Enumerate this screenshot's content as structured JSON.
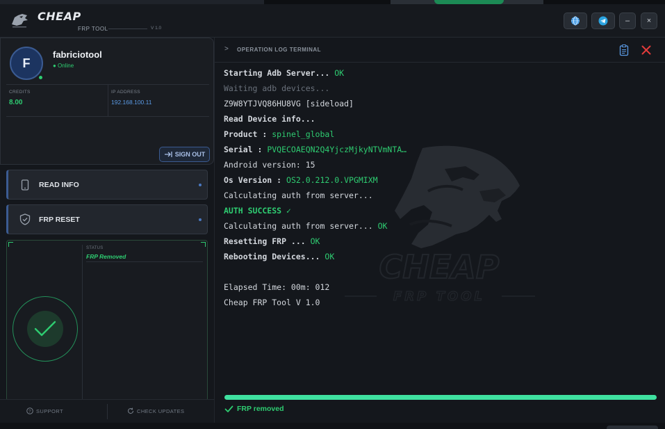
{
  "app": {
    "brand": "CHEAP",
    "subtitle": "FRP TOOL",
    "version": "V 1.0"
  },
  "header": {
    "buttons": [
      {
        "name": "globe-icon"
      },
      {
        "name": "telegram-icon"
      },
      {
        "name": "minimize-icon",
        "label": "–"
      },
      {
        "name": "close-icon",
        "label": "×"
      }
    ]
  },
  "profile": {
    "avatar_initial": "F",
    "username": "fabriciotool",
    "status": "● Online",
    "credits_label": "CREDITS",
    "credits_value": "8.00",
    "ip_label": "IP ADDRESS",
    "ip_value": "192.168.100.11",
    "signout_label": "SIGN OUT"
  },
  "menu": {
    "read_info": "READ INFO",
    "frp_reset": "FRP RESET"
  },
  "status_card": {
    "label": "STATUS",
    "value": "FRP Removed"
  },
  "footer": {
    "support": "SUPPORT",
    "check_updates": "CHECK UPDATES"
  },
  "log": {
    "title": "OPERATION LOG TERMINAL",
    "lines": [
      {
        "text": "Starting Adb Server...",
        "suffix": " OK"
      },
      {
        "text": "Waiting adb devices..."
      },
      {
        "text": "Z9W8YTJVQ86HU8VG [sideload]"
      },
      {
        "text": "Read Device info..."
      },
      {
        "text": "Product : ",
        "suffix": "spinel_global"
      },
      {
        "text": "Serial : ",
        "suffix": "PVQECOAEQN2Q4YjczMjkyNTVmNTA…"
      },
      {
        "text": "Android version: 15"
      },
      {
        "text": "Os Version : ",
        "suffix": "OS2.0.212.0.VPGMIXM"
      },
      {
        "text": "Calculating auth from server..."
      },
      {
        "text": "AUTH SUCCESS  ✓"
      },
      {
        "text": "Calculating auth from server...",
        "suffix": " OK"
      },
      {
        "text": "Resetting FRP ...",
        "suffix": " OK"
      },
      {
        "text": "Rebooting Devices...",
        "suffix": " OK"
      },
      {
        "text": ""
      },
      {
        "text": "Elapsed Time: 00m: 012"
      },
      {
        "text": "Cheap FRP Tool V 1.0"
      }
    ]
  },
  "watermark": {
    "brand": "CHEAP",
    "subtitle": "FRP TOOL"
  },
  "progress": {
    "value": 1.0,
    "label": "FRP removed"
  },
  "colors": {
    "accent": "#2ecc71",
    "link": "#5b9be6",
    "danger": "#e23b3b",
    "background": "#14171c"
  }
}
